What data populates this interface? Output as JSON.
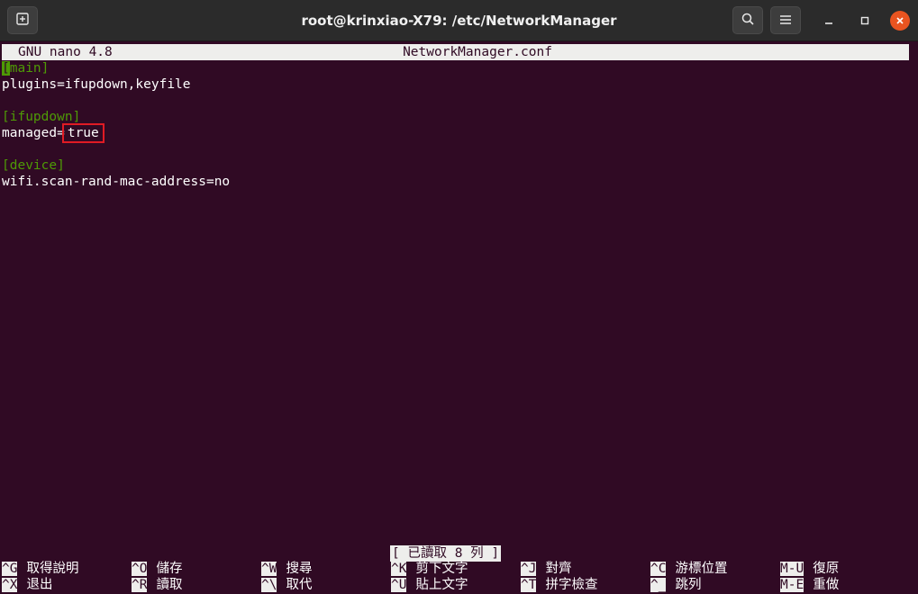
{
  "window": {
    "title": "root@krinxiao-X79: /etc/NetworkManager",
    "icons": {
      "new_tab": "new-tab-icon",
      "search": "search-icon",
      "menu": "hamburger-menu-icon",
      "minimize": "minimize-icon",
      "maximize": "maximize-icon",
      "close": "close-icon"
    },
    "accent_close": "#e95420"
  },
  "nano": {
    "version_label": "GNU nano 4.8",
    "filename": "NetworkManager.conf",
    "lines": {
      "l1_section": "main]",
      "l1_cursor": "[",
      "l2": "plugins=ifupdown,keyfile",
      "l4_section": "[ifupdown]",
      "l5_key": "managed=",
      "l5_value": "true",
      "l7_section": "[device]",
      "l8": "wifi.scan-rand-mac-address=no"
    },
    "status": "[ 已讀取 8 列 ]",
    "shortcuts_row1": [
      {
        "key": "^G",
        "label": "取得說明"
      },
      {
        "key": "^O",
        "label": "儲存"
      },
      {
        "key": "^W",
        "label": "搜尋"
      },
      {
        "key": "^K",
        "label": "剪下文字"
      },
      {
        "key": "^J",
        "label": "對齊"
      },
      {
        "key": "^C",
        "label": "游標位置"
      },
      {
        "key": "M-U",
        "label": "復原"
      }
    ],
    "shortcuts_row2": [
      {
        "key": "^X",
        "label": "退出"
      },
      {
        "key": "^R",
        "label": "讀取"
      },
      {
        "key": "^\\",
        "label": "取代"
      },
      {
        "key": "^U",
        "label": "貼上文字"
      },
      {
        "key": "^T",
        "label": "拼字檢查"
      },
      {
        "key": "^_",
        "label": "跳列"
      },
      {
        "key": "M-E",
        "label": "重做"
      }
    ]
  },
  "colors": {
    "terminal_bg": "#300a24",
    "section_green": "#4e9a06",
    "highlight_red": "#e01b24"
  }
}
